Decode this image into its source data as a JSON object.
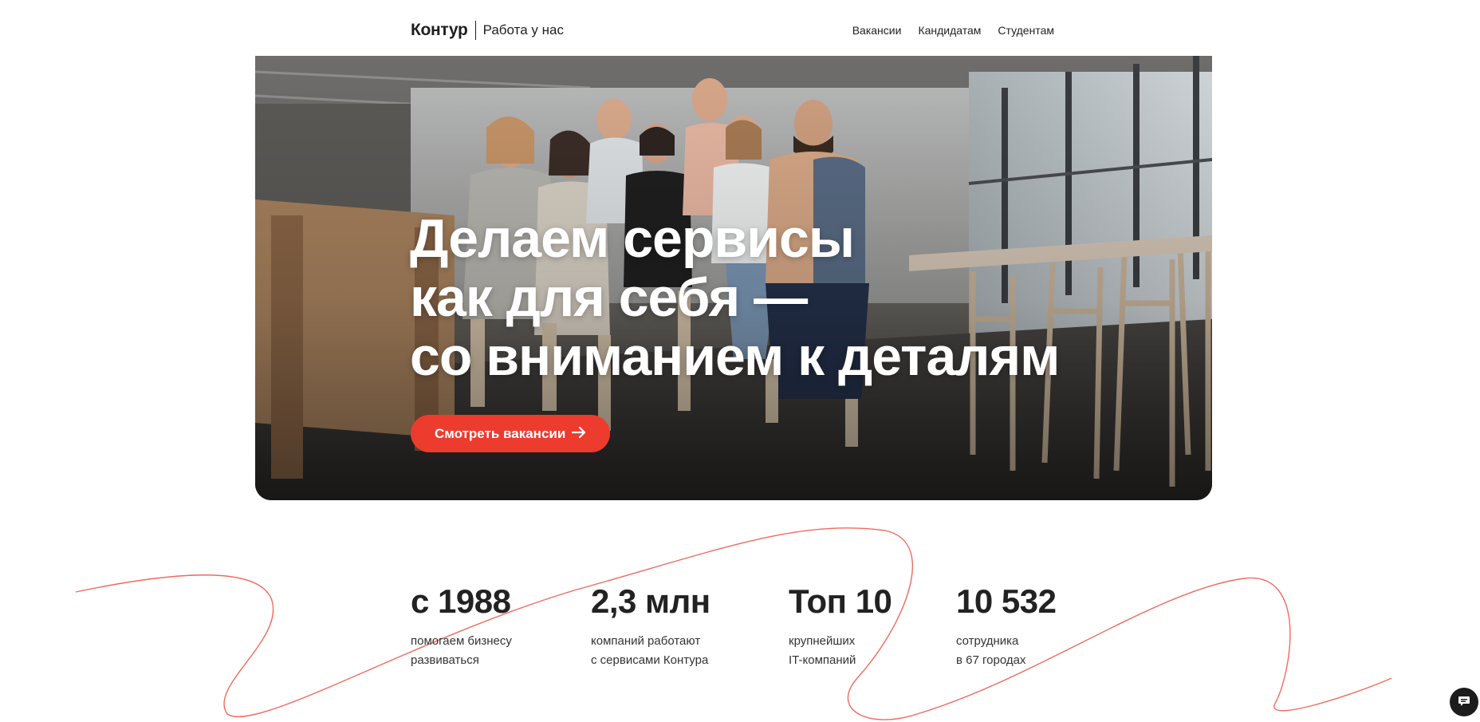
{
  "header": {
    "brand": "Контур",
    "subtitle": "Работа у нас",
    "nav": [
      {
        "label": "Вакансии"
      },
      {
        "label": "Кандидатам"
      },
      {
        "label": "Студентам"
      }
    ]
  },
  "hero": {
    "title_lines": [
      "Делаем сервисы",
      "как для себя —",
      "со вниманием к деталям"
    ],
    "cta_label": "Смотреть вакансии",
    "cta_icon": "arrow-right-icon",
    "image": "team-photo"
  },
  "stats": [
    {
      "value": "с 1988",
      "desc": [
        "помогаем бизнесу",
        "развиваться"
      ]
    },
    {
      "value": "2,3 млн",
      "desc": [
        "компаний работают",
        "с сервисами Контура"
      ]
    },
    {
      "value": "Топ 10",
      "desc": [
        "крупнейших",
        "IT-компаний"
      ]
    },
    {
      "value": "10 532",
      "desc": [
        "сотрудника",
        "в 67 городах"
      ]
    }
  ],
  "chat": {
    "icon": "chat-icon"
  },
  "colors": {
    "accent": "#ed3b2e",
    "text": "#222222",
    "line": "#ef6b5e"
  }
}
